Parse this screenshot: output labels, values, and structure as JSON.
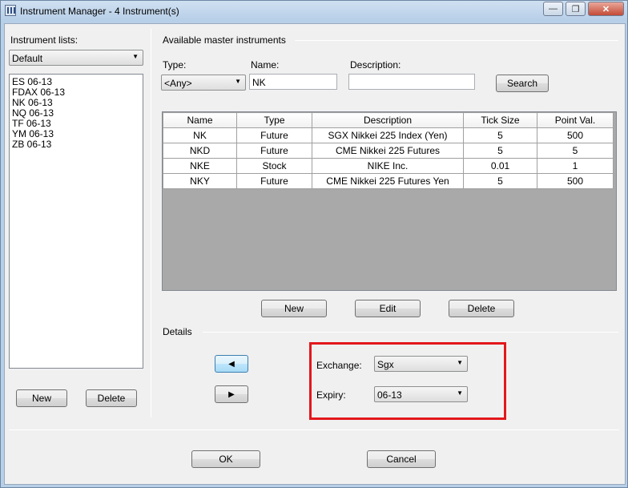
{
  "window": {
    "title": "Instrument Manager - 4 Instrument(s)",
    "minimize_glyph": "—",
    "maximize_glyph": "❐",
    "close_glyph": "✕"
  },
  "left": {
    "lists_label": "Instrument lists:",
    "list_select": "Default",
    "instruments": [
      "ES 06-13",
      "FDAX 06-13",
      "NK 06-13",
      "NQ 06-13",
      "TF 06-13",
      "YM 06-13",
      "ZB 06-13"
    ],
    "new_label": "New",
    "delete_label": "Delete"
  },
  "master": {
    "group_label": "Available master instruments",
    "type_label": "Type:",
    "type_value": "<Any>",
    "name_label": "Name:",
    "name_value": "NK",
    "description_label": "Description:",
    "description_value": "",
    "search_label": "Search",
    "columns": [
      "Name",
      "Type",
      "Description",
      "Tick Size",
      "Point Val."
    ],
    "rows": [
      [
        "NK",
        "Future",
        "SGX Nikkei 225 Index (Yen)",
        "5",
        "500"
      ],
      [
        "NKD",
        "Future",
        "CME Nikkei 225 Futures",
        "5",
        "5"
      ],
      [
        "NKE",
        "Stock",
        "NIKE Inc.",
        "0.01",
        "1"
      ],
      [
        "NKY",
        "Future",
        "CME Nikkei 225 Futures Yen",
        "5",
        "500"
      ]
    ],
    "new_label": "New",
    "edit_label": "Edit",
    "delete_label": "Delete"
  },
  "details": {
    "group_label": "Details",
    "exchange_label": "Exchange:",
    "exchange_value": "Sgx",
    "expiry_label": "Expiry:",
    "expiry_value": "06-13",
    "highlight_color": "#e3171c"
  },
  "footer": {
    "ok_label": "OK",
    "cancel_label": "Cancel"
  },
  "icons": {
    "left_arrow": "◀",
    "right_arrow": "▶",
    "dropdown": "▼"
  }
}
